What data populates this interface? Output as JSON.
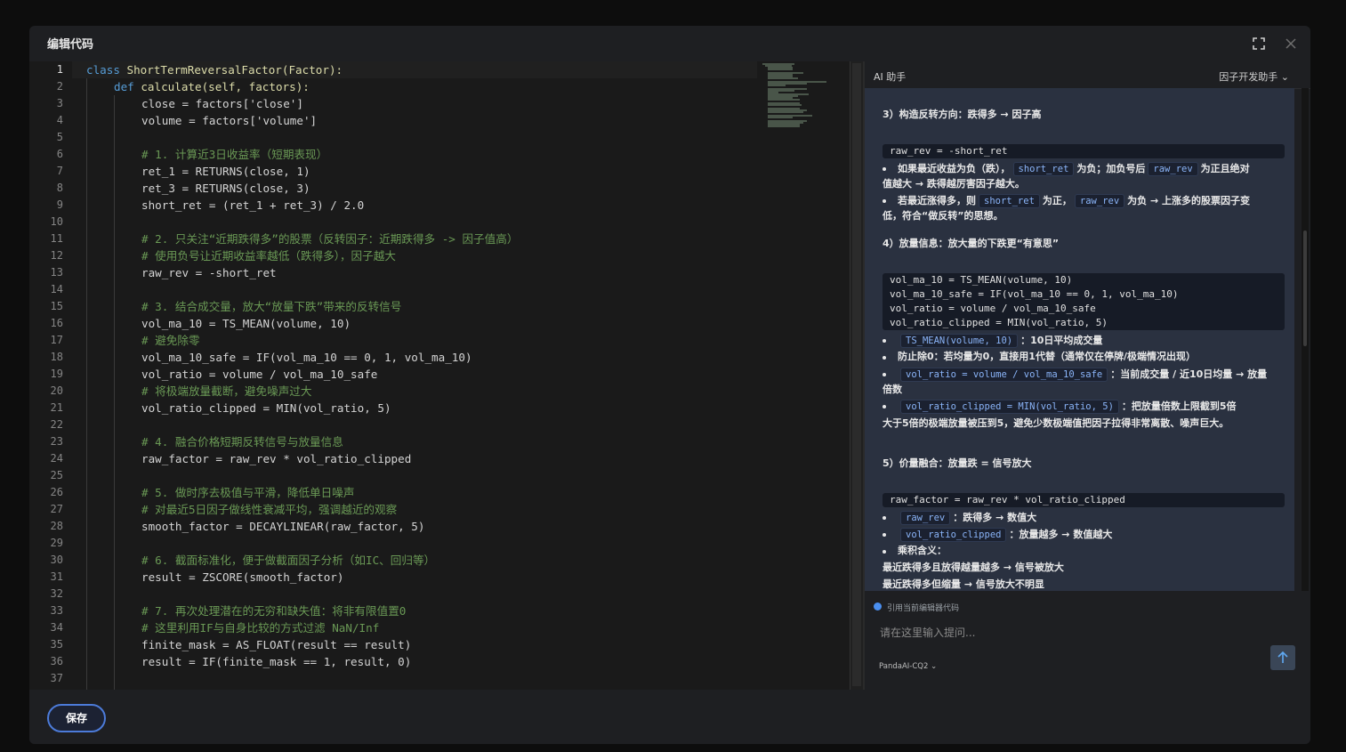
{
  "modal": {
    "title": "编辑代码"
  },
  "header_icons": {
    "fullscreen": "fullscreen-icon",
    "close": "close-icon"
  },
  "editor": {
    "line_numbers": [
      "1",
      "2",
      "3",
      "4",
      "5",
      "6",
      "7",
      "8",
      "9",
      "10",
      "11",
      "12",
      "13",
      "14",
      "15",
      "16",
      "17",
      "18",
      "19",
      "20",
      "21",
      "22",
      "23",
      "24",
      "25",
      "26",
      "27",
      "28",
      "29",
      "30",
      "31",
      "32",
      "33",
      "34",
      "35",
      "36",
      "37"
    ],
    "current_line": 1,
    "code": {
      "l1": {
        "kw": "class",
        "rest": " ShortTermReversalFactor(Factor):"
      },
      "l2": {
        "kw": "def",
        "rest": " calculate(self, factors):"
      },
      "l3": "close = factors['close']",
      "l4": "volume = factors['volume']",
      "l6": "# 1. 计算近3日收益率（短期表现）",
      "l7": "ret_1 = RETURNS(close, 1)",
      "l8": "ret_3 = RETURNS(close, 3)",
      "l9": "short_ret = (ret_1 + ret_3) / 2.0",
      "l11": "# 2. 只关注“近期跌得多”的股票（反转因子：近期跌得多 -> 因子值高）",
      "l12": "# 使用负号让近期收益率越低（跌得多），因子越大",
      "l13": "raw_rev = -short_ret",
      "l15": "# 3. 结合成交量，放大“放量下跌”带来的反转信号",
      "l16": "vol_ma_10 = TS_MEAN(volume, 10)",
      "l17": "# 避免除零",
      "l18": "vol_ma_10_safe = IF(vol_ma_10 == 0, 1, vol_ma_10)",
      "l19": "vol_ratio = volume / vol_ma_10_safe",
      "l20": "# 将极端放量截断，避免噪声过大",
      "l21": "vol_ratio_clipped = MIN(vol_ratio, 5)",
      "l23": "# 4. 融合价格短期反转信号与放量信息",
      "l24": "raw_factor = raw_rev * vol_ratio_clipped",
      "l26": "# 5. 做时序去极值与平滑，降低单日噪声",
      "l27": "# 对最近5日因子做线性衰减平均，强调越近的观察",
      "l28": "smooth_factor = DECAYLINEAR(raw_factor, 5)",
      "l30": "# 6. 截面标准化，便于做截面因子分析（如IC、回归等）",
      "l31": "result = ZSCORE(smooth_factor)",
      "l33": "# 7. 再次处理潜在的无穷和缺失值：将非有限值置0",
      "l34": "# 这里利用IF与自身比较的方式过滤 NaN/Inf",
      "l35": "finite_mask = AS_FLOAT(result == result)",
      "l36": "result = IF(finite_mask == 1, result, 0)"
    }
  },
  "ai": {
    "label": "AI 助手",
    "mode": "因子开发助手 ⌄",
    "s3": {
      "heading": "3）构造反转方向：跌得多 → 因子高",
      "code": "raw_rev = -short_ret",
      "b1_pre": "如果最近收益为负（跌），",
      "b1_chip1": "short_ret",
      "b1_mid": "为负；加负号后",
      "b1_chip2": "raw_rev",
      "b1_post": "为正且绝对",
      "b1_line2": "值越大 → 跌得越厉害因子越大。",
      "b2_pre": "若最近涨得多，则",
      "b2_chip1": "short_ret",
      "b2_mid": "为正，",
      "b2_chip2": "raw_rev",
      "b2_post": "为负 → 上涨多的股票因子变",
      "b2_line2": "低，符合“做反转”的思想。"
    },
    "s4": {
      "heading": "4）放量信息：放大量的下跌更“有意思”",
      "code": [
        "vol_ma_10 = TS_MEAN(volume, 10)",
        "vol_ma_10_safe = IF(vol_ma_10 == 0, 1, vol_ma_10)",
        "vol_ratio = volume / vol_ma_10_safe",
        "vol_ratio_clipped = MIN(vol_ratio, 5)"
      ],
      "b1_chip": "TS_MEAN(volume, 10)",
      "b1_text": "：10日平均成交量",
      "b2_text": "防止除0：若均量为0，直接用1代替（通常仅在停牌/极端情况出现）",
      "b3_chip": "vol_ratio = volume / vol_ma_10_safe",
      "b3_text": "：当前成交量 / 近10日均量 → 放量",
      "b3_line2": "倍数",
      "b4_chip": "vol_ratio_clipped = MIN(vol_ratio, 5)",
      "b4_text": "：把放量倍数上限截到5倍",
      "b4_line2": "大于5倍的极端放量被压到5，避免少数极端值把因子拉得非常离散、噪声巨大。"
    },
    "s5": {
      "heading": "5）价量融合：放量跌 = 信号放大",
      "code": "raw_factor = raw_rev * vol_ratio_clipped",
      "b1_chip": "raw_rev",
      "b1_text": "：跌得多 → 数值大",
      "b2_chip": "vol_ratio_clipped",
      "b2_text": "：放量越多 → 数值越大",
      "b3_text": "乘积含义：",
      "t1": "最近跌得多且放得越量越多 → 信号被放大",
      "t2": "最近跌得多但缩量 → 信号放大不明显"
    },
    "footer": {
      "reference": "引用当前编辑器代码",
      "placeholder": "请在这里输入提问...",
      "model": "PandaAI-CQ2 ⌄",
      "send_icon": "arrow-up-icon"
    }
  },
  "footer": {
    "save_label": "保存"
  }
}
